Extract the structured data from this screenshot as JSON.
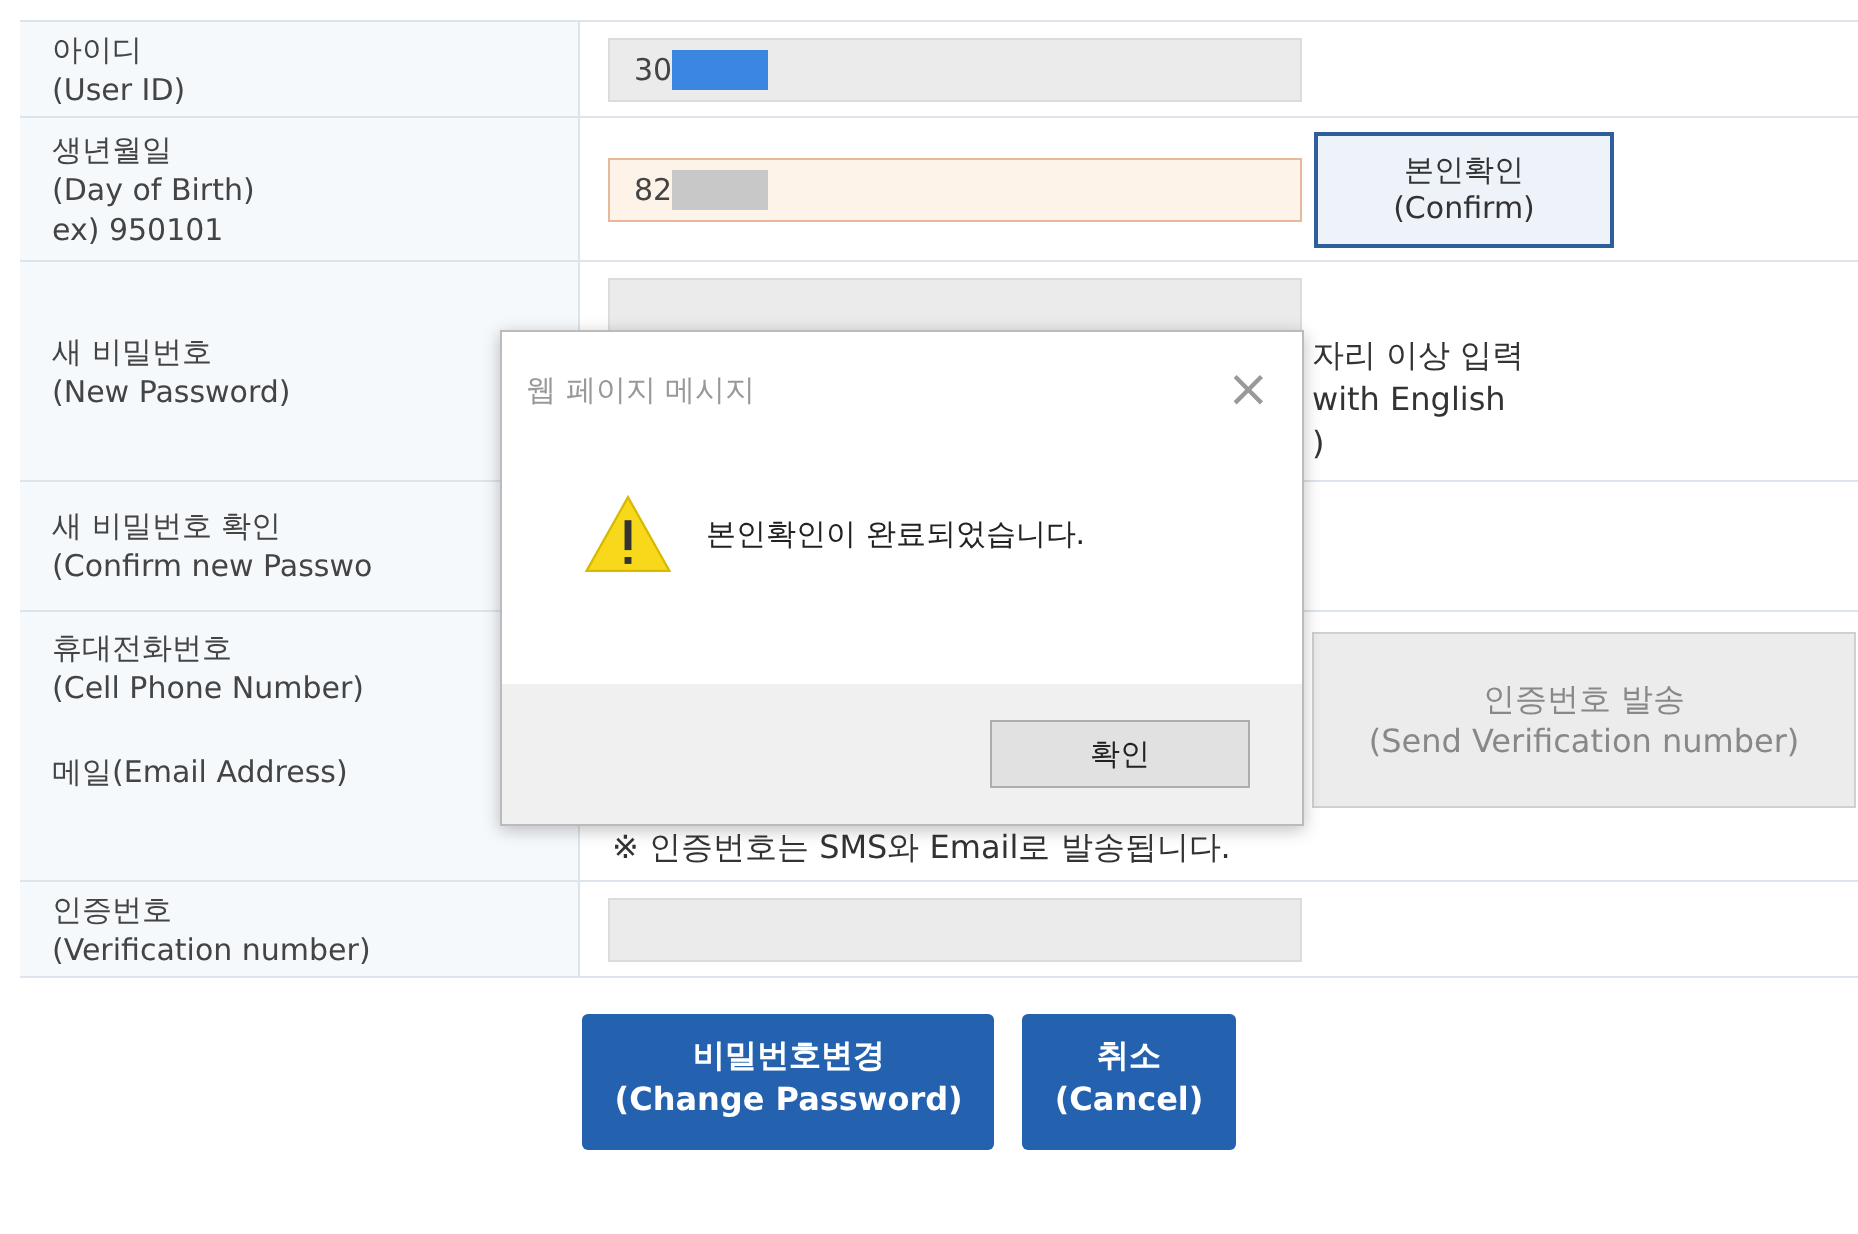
{
  "form": {
    "rows": [
      {
        "kind": "input",
        "label": [
          "아이디",
          "(User ID)"
        ],
        "value": "30",
        "color": "#3a86e0"
      },
      {
        "kind": "confirm",
        "label": [
          "생년월일",
          "(Day of Birth)",
          "ex) 950101"
        ],
        "value": "82",
        "color": "#c8c8c8",
        "button": [
          "본인확인",
          "(Confirm)"
        ]
      },
      {
        "kind": "password",
        "label": [
          "새 비밀번호",
          "(New Password)"
        ],
        "note": [
          "자리 이상 입력",
          "with English",
          ")"
        ]
      },
      {
        "kind": "blank",
        "label": [
          "새 비밀번호 확인",
          "(Confirm new Passwo"
        ]
      },
      {
        "kind": "send",
        "label": [
          "휴대전화번호",
          "(Cell Phone Number)"
        ],
        "label2": "메일(Email Address)",
        "button": [
          "인증번호 발송",
          "(Send Verification number)"
        ],
        "note": "※ 인증번호는 SMS와 Email로 발송됩니다."
      },
      {
        "kind": "input",
        "label": [
          "인증번호",
          "(Verification number)"
        ]
      }
    ]
  },
  "buttons": [
    [
      "비밀번호변경",
      "(Change Password)"
    ],
    [
      "취소",
      "(Cancel)"
    ]
  ],
  "dialog": {
    "title": "웹 페이지 메시지",
    "close": "×",
    "message": "본인확인이 완료되었습니다.",
    "button": "확인"
  }
}
